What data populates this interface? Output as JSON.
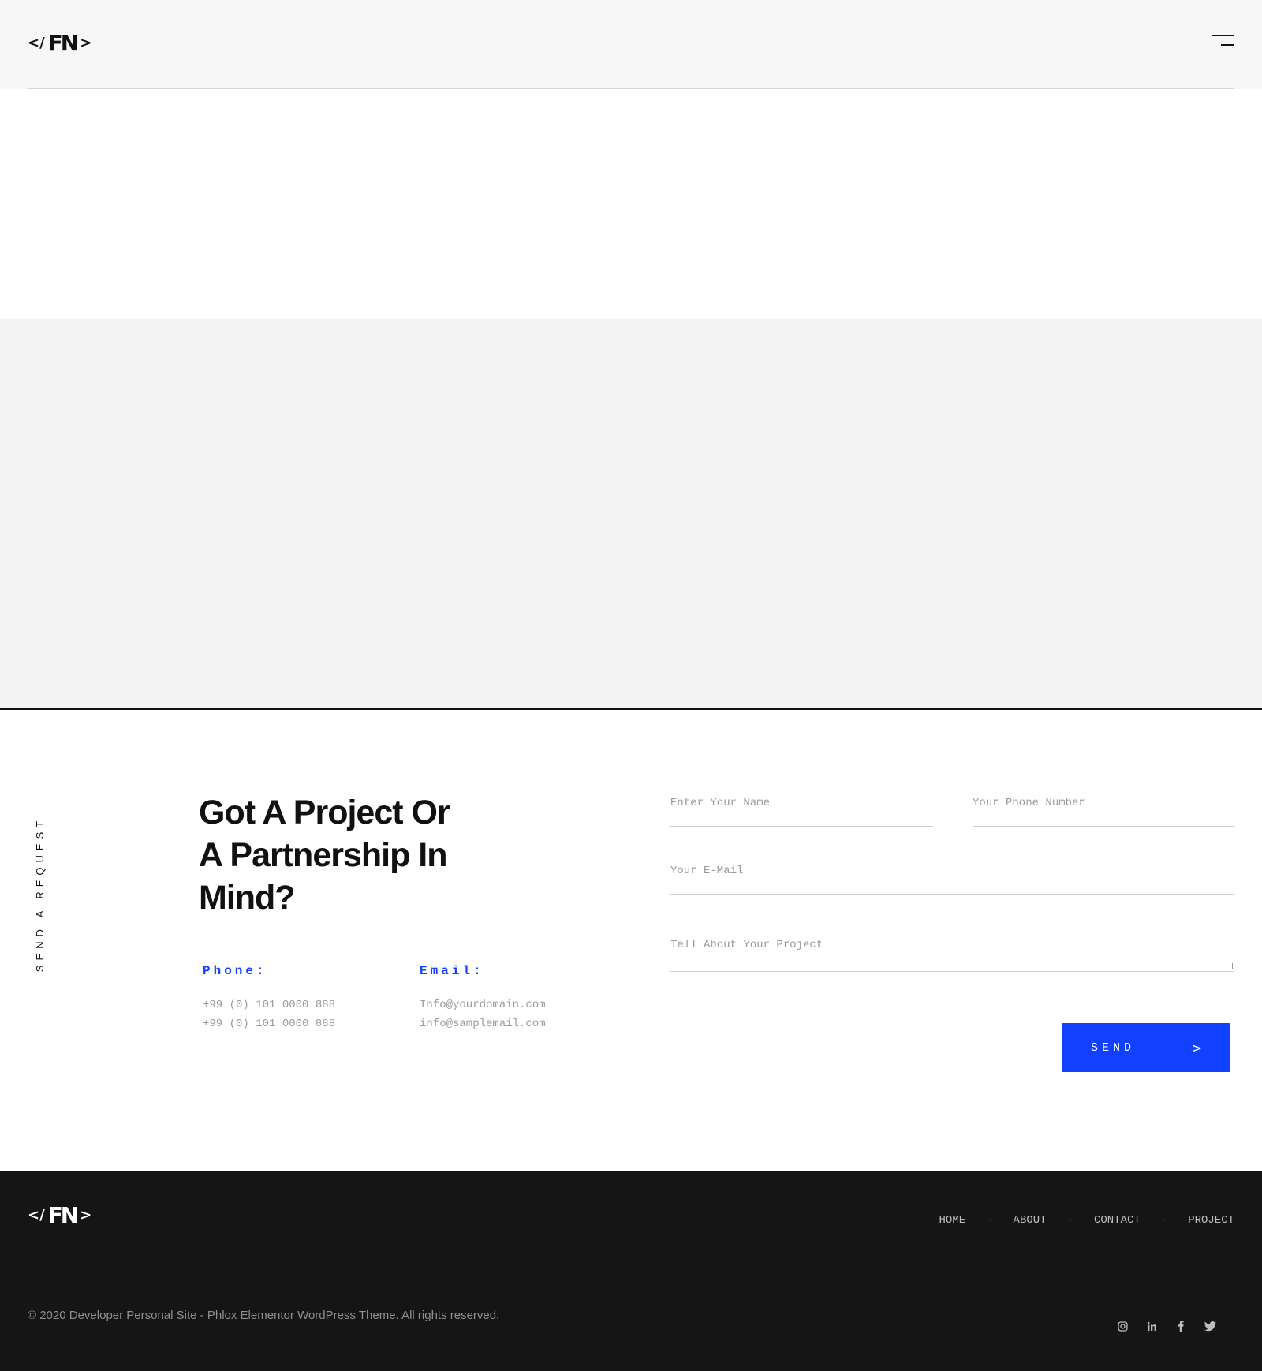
{
  "header": {
    "logo_left": "</",
    "logo_mark": "FN",
    "logo_right": ">"
  },
  "contact": {
    "vertical_label": "SEND A REQUEST",
    "headline_line1": "Got A Project Or",
    "headline_line2": "A Partnership In",
    "headline_line3": "Mind?",
    "phone_label": "Phone:",
    "phones": [
      "+99 (0) 101 0000 888",
      "+99 (0) 101 0000 888"
    ],
    "email_label": "Email:",
    "emails": [
      "Info@yourdomain.com",
      "info@samplemail.com"
    ]
  },
  "form": {
    "name_placeholder": "Enter Your Name",
    "phone_placeholder": "Your Phone Number",
    "email_placeholder": "Your E-Mail",
    "project_placeholder": "Tell About Your Project",
    "send_label": "SEND",
    "send_arrow": ">"
  },
  "footer": {
    "nav": [
      "HOME",
      "ABOUT",
      "CONTACT",
      "PROJECT"
    ],
    "separator": "-",
    "copyright": "© 2020 Developer Personal Site - Phlox Elementor WordPress Theme. All rights reserved.",
    "socials": [
      "instagram-icon",
      "linkedin-icon",
      "facebook-icon",
      "twitter-icon"
    ]
  },
  "colors": {
    "accent": "#1141ff",
    "footer_bg": "#151515",
    "hero_bg": "#f4f4f4"
  }
}
